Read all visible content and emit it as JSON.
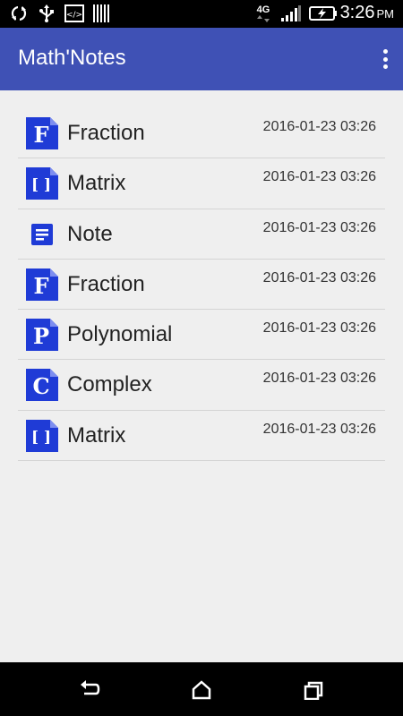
{
  "status_bar": {
    "time": "3:26",
    "ampm": "PM",
    "network": "4G",
    "icons": [
      "sync-icon",
      "usb-icon",
      "debug-icon",
      "barcode-icon",
      "network-4g-icon",
      "signal-icon",
      "battery-charging-icon"
    ]
  },
  "app_bar": {
    "title": "Math'Notes",
    "menu_icon": "overflow-menu-icon",
    "color": "#3f51b5"
  },
  "notes": [
    {
      "name": "Fraction",
      "date": "2016-01-23 03:26",
      "icon": "fraction-icon",
      "glyph": "F"
    },
    {
      "name": "Matrix",
      "date": "2016-01-23 03:26",
      "icon": "matrix-icon",
      "glyph": "[ ]"
    },
    {
      "name": "Note",
      "date": "2016-01-23 03:26",
      "icon": "note-icon",
      "glyph": ""
    },
    {
      "name": "Fraction",
      "date": "2016-01-23 03:26",
      "icon": "fraction-icon",
      "glyph": "F"
    },
    {
      "name": "Polynomial",
      "date": "2016-01-23 03:26",
      "icon": "polynomial-icon",
      "glyph": "P"
    },
    {
      "name": "Complex",
      "date": "2016-01-23 03:26",
      "icon": "complex-icon",
      "glyph": "C"
    },
    {
      "name": "Matrix",
      "date": "2016-01-23 03:26",
      "icon": "matrix-icon",
      "glyph": "[ ]"
    }
  ],
  "fab": {
    "icon": "add-icon",
    "color": "#3f51b5"
  },
  "nav_bar": {
    "icons": [
      "back-icon",
      "home-icon",
      "recents-icon"
    ]
  },
  "colors": {
    "accent": "#3f51b5",
    "icon_blue": "#1f3bd6",
    "background": "#efefef"
  }
}
